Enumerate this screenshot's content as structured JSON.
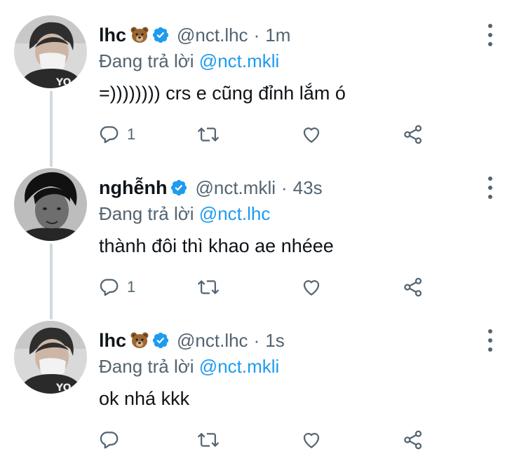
{
  "tweets": [
    {
      "name": "lhc",
      "emoji_icon": "bear-face-emoji",
      "verified": true,
      "handle": "@nct.lhc",
      "dot": "·",
      "time": "1m",
      "replying_prefix": "Đang trả lời",
      "replying_to": "@nct.mkli",
      "text": "=)))))))) crs e cũng đỉnh lắm ó",
      "reply_count": "1"
    },
    {
      "name": "nghễnh",
      "emoji_icon": "",
      "verified": true,
      "handle": "@nct.mkli",
      "dot": "·",
      "time": "43s",
      "replying_prefix": "Đang trả lời",
      "replying_to": "@nct.lhc",
      "text": "thành đôi thì khao ae nhéee",
      "reply_count": "1"
    },
    {
      "name": "lhc",
      "emoji_icon": "bear-face-emoji",
      "verified": true,
      "handle": "@nct.lhc",
      "dot": "·",
      "time": "1s",
      "replying_prefix": "Đang trả lời",
      "replying_to": "@nct.mkli",
      "text": "ok nhá kkk",
      "reply_count": ""
    }
  ],
  "colors": {
    "primary_text": "#0f1419",
    "secondary_text": "#536471",
    "link": "#1d9bf0",
    "verified": "#1d9bf0",
    "thread_line": "#cfd9de"
  }
}
